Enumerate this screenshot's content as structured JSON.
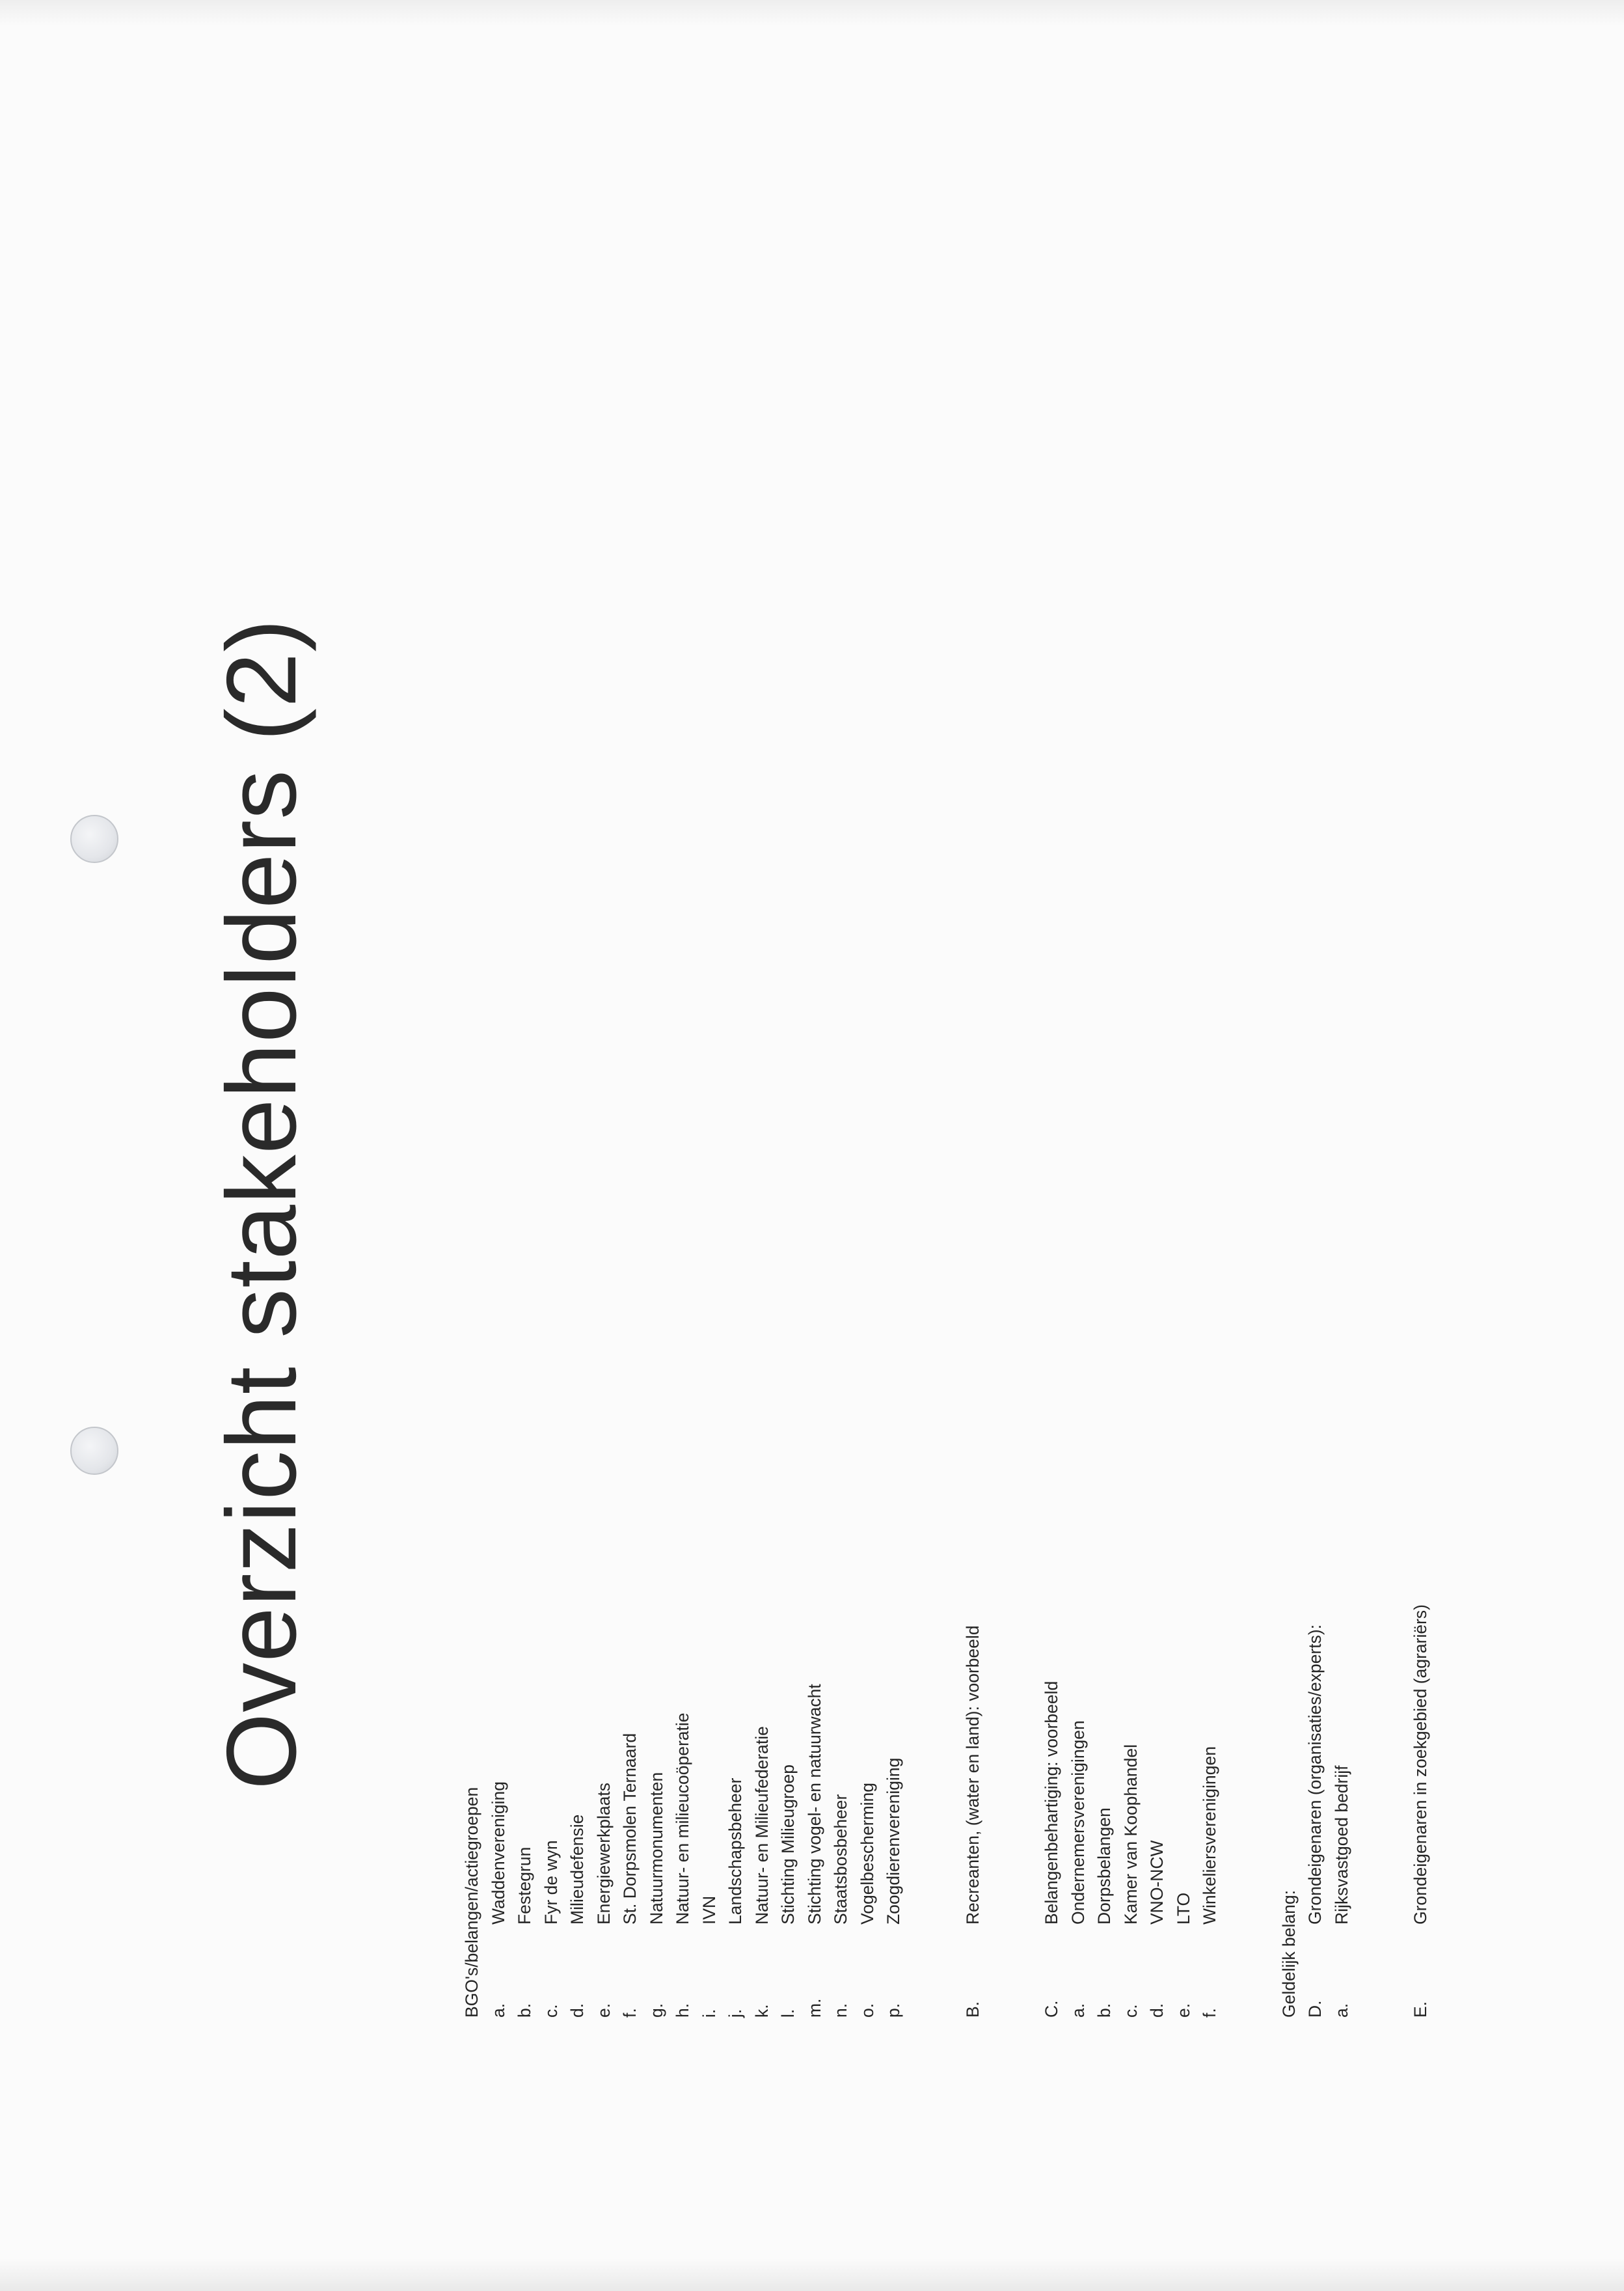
{
  "title": "Overzicht stakeholders (2)",
  "sections": {
    "bgo": {
      "header": "BGO's/belangen/actiegroepen",
      "items": [
        {
          "mark": "a.",
          "text": "Waddenvereniging"
        },
        {
          "mark": "b.",
          "text": "Festegrun"
        },
        {
          "mark": "c.",
          "text": "Fyr de wyn"
        },
        {
          "mark": "d.",
          "text": "Milieudefensie"
        },
        {
          "mark": "e.",
          "text": "Energiewerkplaats"
        },
        {
          "mark": "f.",
          "text": "St. Dorpsmolen Ternaard"
        },
        {
          "mark": "g.",
          "text": "Natuurmonumenten"
        },
        {
          "mark": "h.",
          "text": "Natuur- en milieucoöperatie"
        },
        {
          "mark": "i.",
          "text": "IVN"
        },
        {
          "mark": "j.",
          "text": "Landschapsbeheer"
        },
        {
          "mark": "k.",
          "text": "Natuur- en Milieufederatie"
        },
        {
          "mark": "l.",
          "text": "Stichting Milieugroep"
        },
        {
          "mark": "m.",
          "text": "Stichting vogel- en natuurwacht"
        },
        {
          "mark": "n.",
          "text": "Staatsbosbeheer"
        },
        {
          "mark": "o.",
          "text": "Vogelbescherming"
        },
        {
          "mark": "p.",
          "text": "Zoogdierenvereniging"
        }
      ]
    },
    "b": {
      "mark": "B.",
      "text": "Recreanten, (water en land): voorbeeld"
    },
    "c": {
      "mark": "C.",
      "text": "Belangenbehartiging: voorbeeld",
      "items": [
        {
          "mark": "a.",
          "text": "Ondernemersverenigingen"
        },
        {
          "mark": "b.",
          "text": "Dorpsbelangen"
        },
        {
          "mark": "c.",
          "text": "Kamer van Koophandel"
        },
        {
          "mark": "d.",
          "text": "VNO-NCW"
        },
        {
          "mark": "e.",
          "text": "LTO"
        },
        {
          "mark": "f.",
          "text": "Winkeliersverenigingen"
        }
      ]
    },
    "geldelijk": {
      "header": "Geldelijk belang:",
      "d": {
        "mark": "D.",
        "text": "Grondeigenaren (organisaties/experts):"
      },
      "d_items": [
        {
          "mark": "a.",
          "text": "Rijksvastgoed bedrijf"
        }
      ],
      "e": {
        "mark": "E.",
        "text": "Grondeigenaren in zoekgebied (agrariërs)"
      }
    }
  }
}
